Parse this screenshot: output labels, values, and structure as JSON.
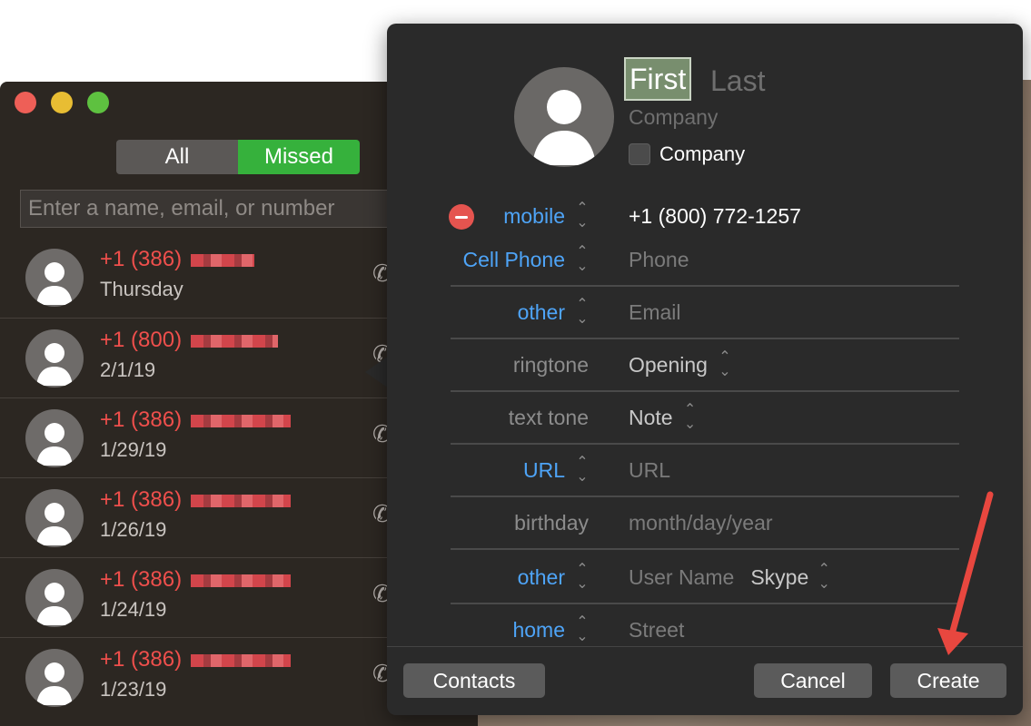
{
  "facetime": {
    "segments": {
      "all": "All",
      "missed": "Missed"
    },
    "search": {
      "placeholder": "Enter a name, email, or number"
    },
    "calls": [
      {
        "number": "+1 (386)",
        "date": "Thursday"
      },
      {
        "number": "+1 (800)",
        "date": "2/1/19"
      },
      {
        "number": "+1 (386)",
        "date": "1/29/19"
      },
      {
        "number": "+1 (386)",
        "date": "1/26/19"
      },
      {
        "number": "+1 (386)",
        "date": "1/24/19"
      },
      {
        "number": "+1 (386)",
        "date": "1/23/19"
      }
    ],
    "colors": {
      "missed_green": "#36b13c",
      "missed_red": "#ef4f4c"
    }
  },
  "contact_card": {
    "first_name": "First",
    "last_name_placeholder": "Last",
    "company_placeholder": "Company",
    "company_checkbox_label": "Company",
    "fields": {
      "mobile": {
        "label": "mobile",
        "value": "+1 (800) 772-1257"
      },
      "cell": {
        "label": "Cell Phone",
        "placeholder": "Phone"
      },
      "email": {
        "label": "other",
        "placeholder": "Email"
      },
      "ringtone": {
        "label": "ringtone",
        "value": "Opening"
      },
      "texttone": {
        "label": "text tone",
        "value": "Note"
      },
      "url": {
        "label": "URL",
        "placeholder": "URL"
      },
      "birthday": {
        "label": "birthday",
        "placeholder": "month/day/year"
      },
      "im": {
        "label": "other",
        "placeholder": "User Name",
        "service": "Skype"
      },
      "address": {
        "label": "home",
        "placeholder": "Street"
      }
    },
    "buttons": {
      "contacts": "Contacts",
      "cancel": "Cancel",
      "create": "Create"
    },
    "colors": {
      "label_blue": "#4ea4f7",
      "annotation_red": "#e8473f"
    }
  }
}
